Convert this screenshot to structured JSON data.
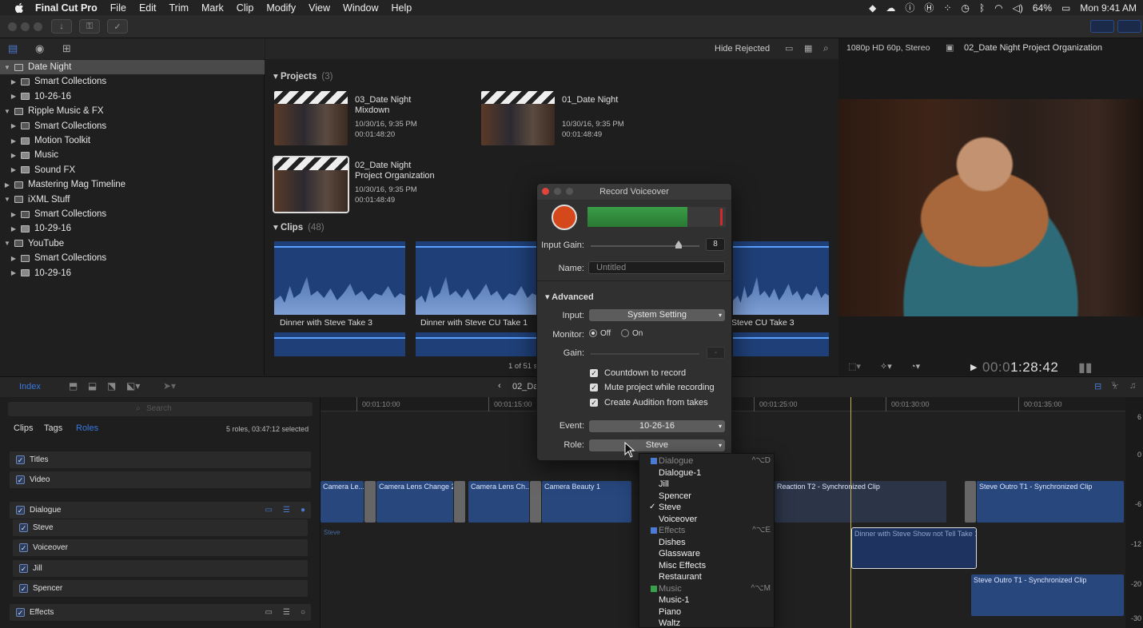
{
  "menubar": {
    "app": "Final Cut Pro",
    "items": [
      "File",
      "Edit",
      "Trim",
      "Mark",
      "Clip",
      "Modify",
      "View",
      "Window",
      "Help"
    ],
    "battery": "64%",
    "clock": "Mon 9:41 AM"
  },
  "library": {
    "rows": [
      {
        "label": "Date Night",
        "level": 0,
        "expanded": true,
        "selected": true
      },
      {
        "label": "Smart Collections",
        "level": 1
      },
      {
        "label": "10-26-16",
        "level": 1
      },
      {
        "label": "Ripple Music & FX",
        "level": 0,
        "expanded": true
      },
      {
        "label": "Smart Collections",
        "level": 1
      },
      {
        "label": "Motion Toolkit",
        "level": 1
      },
      {
        "label": "Music",
        "level": 1
      },
      {
        "label": "Sound FX",
        "level": 1
      },
      {
        "label": "Mastering Mag Timeline",
        "level": 0
      },
      {
        "label": "iXML Stuff",
        "level": 0,
        "expanded": true
      },
      {
        "label": "Smart Collections",
        "level": 1
      },
      {
        "label": "10-29-16",
        "level": 1
      },
      {
        "label": "YouTube",
        "level": 0,
        "expanded": true
      },
      {
        "label": "Smart Collections",
        "level": 1
      },
      {
        "label": "10-29-16",
        "level": 1
      }
    ]
  },
  "browser": {
    "filter": "Hide Rejected",
    "format": "1080p HD 60p, Stereo",
    "project_name": "02_Date Night Project Organization",
    "projects_heading": "Projects",
    "projects_count": "(3)",
    "clips_heading": "Clips",
    "clips_count": "(48)",
    "projects": [
      {
        "title1": "03_Date Night",
        "title2": "Mixdown",
        "date": "10/30/16, 9:35 PM",
        "duration": "00:01:48:20"
      },
      {
        "title1": "01_Date Night",
        "title2": "",
        "date": "10/30/16, 9:35 PM",
        "duration": "00:01:48:49"
      },
      {
        "title1": "02_Date Night",
        "title2": "Project Organization",
        "date": "10/30/16, 9:35 PM",
        "duration": "00:01:48:49"
      }
    ],
    "clips": [
      "Dinner with Steve Take 3",
      "Dinner with Steve CU Take 1",
      "Steve CU Take 3"
    ],
    "selection_status": "1 of 51 s"
  },
  "viewer": {
    "timecode_dim": "00:0",
    "timecode": "1:28:42"
  },
  "index": {
    "tab_index": "Index",
    "search_placeholder": "Search",
    "tabs": [
      "Clips",
      "Tags",
      "Roles"
    ],
    "roles_summary": "5 roles, 03:47:12 selected",
    "roles": [
      {
        "label": "Titles"
      },
      {
        "label": "Video"
      },
      {
        "label": "Dialogue"
      },
      {
        "label": "Steve"
      },
      {
        "label": "Voiceover"
      },
      {
        "label": "Jill"
      },
      {
        "label": "Spencer"
      },
      {
        "label": "Effects"
      }
    ]
  },
  "timeline": {
    "nav_label": "02_Dat",
    "ticks": [
      "00:01:10:00",
      "00:01:15:00",
      "00:01:25:00",
      "00:01:30:00",
      "00:01:35:00"
    ],
    "clips": [
      "Camera Le...",
      "Camera Lens Change 2",
      "Camera Lens Ch...",
      "Camera Beauty 1",
      "Reaction T2 - Synchronized Clip",
      "Steve Outro T1 - Synchronized Clip",
      "Dinner with Steve Show not Tell Take 1",
      "Steve Outro T1 - Synchronized Clip"
    ],
    "lane_label": "Steve",
    "meter_labels": [
      "6",
      "0",
      "-6",
      "-12",
      "-20",
      "-30"
    ]
  },
  "record_voiceover": {
    "title": "Record Voiceover",
    "input_gain_label": "Input Gain:",
    "input_gain_value": "8",
    "name_label": "Name:",
    "name_placeholder": "Untitled",
    "advanced_label": "Advanced",
    "input_label": "Input:",
    "input_value": "System Setting",
    "monitor_label": "Monitor:",
    "monitor_off": "Off",
    "monitor_on": "On",
    "gain_label": "Gain:",
    "gain_value": "-",
    "countdown": "Countdown to record",
    "mute": "Mute project while recording",
    "audition": "Create Audition from takes",
    "event_label": "Event:",
    "event_value": "10-26-16",
    "role_label": "Role:",
    "role_value": "Steve"
  },
  "role_menu": {
    "items": [
      {
        "label": "Dialogue",
        "header": true,
        "shortcut": "^⌥D",
        "color": "#4a7bd0"
      },
      {
        "label": "Dialogue-1"
      },
      {
        "label": "Jill"
      },
      {
        "label": "Spencer"
      },
      {
        "label": "Steve",
        "checked": true
      },
      {
        "label": "Voiceover"
      },
      {
        "label": "Effects",
        "header": true,
        "shortcut": "^⌥E",
        "color": "#4a7bd0"
      },
      {
        "label": "Dishes"
      },
      {
        "label": "Glassware"
      },
      {
        "label": "Misc Effects"
      },
      {
        "label": "Restaurant"
      },
      {
        "label": "Music",
        "header": true,
        "shortcut": "^⌥M",
        "color": "#3aa04a"
      },
      {
        "label": "Music-1"
      },
      {
        "label": "Piano"
      },
      {
        "label": "Waltz"
      }
    ]
  },
  "colors": {
    "clip_blue": "#27477d",
    "playhead": "#c9b34a",
    "record_red": "#d4481c",
    "meter_green": "#2e8b3a"
  }
}
